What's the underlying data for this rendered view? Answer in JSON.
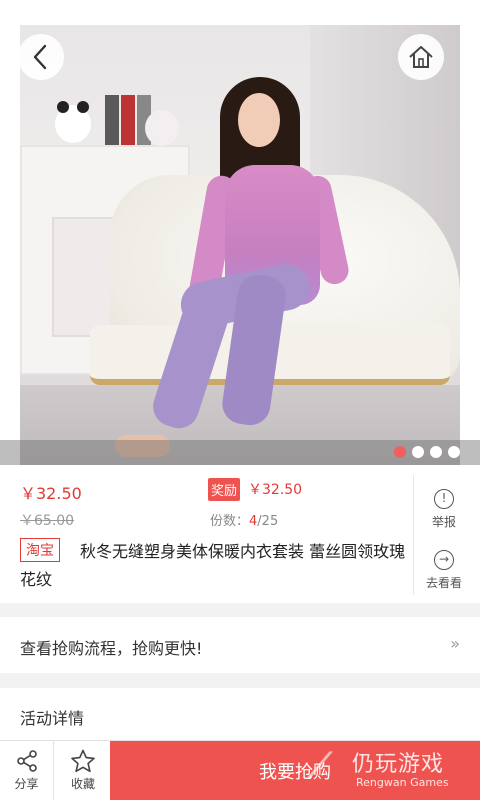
{
  "header": {
    "back_icon": "chevron-left-icon",
    "home_icon": "home-icon"
  },
  "carousel": {
    "total": 4,
    "active_index": 0
  },
  "product": {
    "price": "￥32.50",
    "original_price": "￥65.00",
    "reward_label": "奖励",
    "reward_price": "￥32.50",
    "share_label": "份数：",
    "share_current": "4",
    "share_total": "/25",
    "platform_tag": "淘宝",
    "title": "秋冬无缝塑身美体保暖内衣套装 蕾丝圆领玫瑰花纹"
  },
  "side_actions": {
    "report_label": "举报",
    "goto_label": "去看看"
  },
  "flow": {
    "text": "查看抢购流程，抢购更快!",
    "arrow": "»"
  },
  "detail": {
    "title": "活动详情"
  },
  "bottom_bar": {
    "share_label": "分享",
    "favorite_label": "收藏",
    "buy_label": "我要抢购"
  },
  "watermark": {
    "cn": "仍玩游戏",
    "en": "Rengwan Games"
  },
  "colors": {
    "accent": "#ef5350",
    "price": "#e53935"
  }
}
